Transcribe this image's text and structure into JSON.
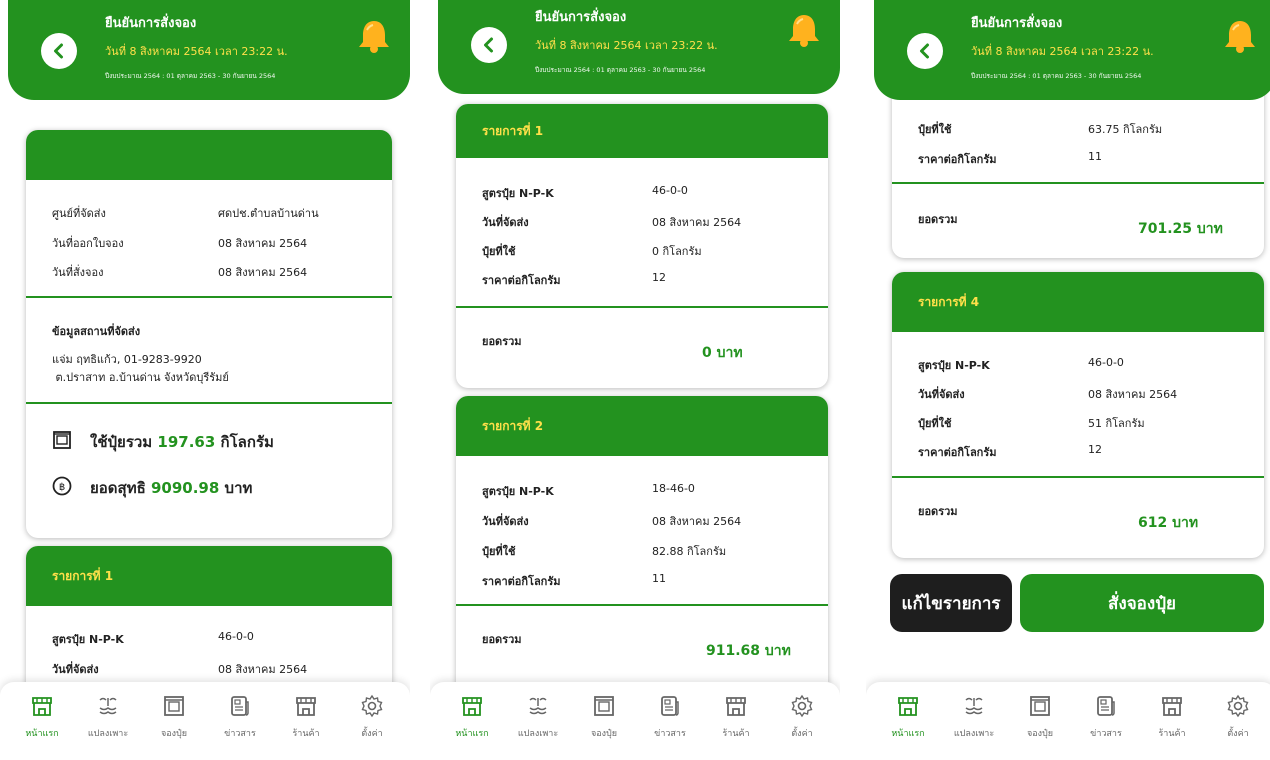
{
  "header": {
    "title": "ยืนยันการสั่งจอง",
    "date": "วันที่ 8 สิงหาคม 2564 เวลา 23:22 น.",
    "budget": "ปีงบประมาณ 2564 : 01 ตุลาคม 2563 - 30 กันยายน 2564"
  },
  "summary": {
    "center_label": "ศูนย์ที่จัดส่ง",
    "center_value": "ศดปช.ตำบลบ้านด่าน",
    "issue_label": "วันที่ออกใบจอง",
    "issue_value": "08 สิงหาคม 2564",
    "order_label": "วันที่สั่งจอง",
    "order_value": "08 สิงหาคม 2564",
    "address_title": "ข้อมูลสถานที่จัดส่ง",
    "address_line1": "แจ่ม ฤทธิแก้ว, 01-9283-9920",
    "address_line2": " ต.ปราสาท อ.บ้านด่าน จังหวัดบุรีรัมย์",
    "total_kg_prefix": "ใช้ปุ๋ยรวม",
    "total_kg_value": "197.63",
    "total_kg_unit": "กิโลกรัม",
    "net_prefix": "ยอดสุทธิ",
    "net_value": "9090.98",
    "net_unit": "บาท"
  },
  "labels": {
    "formula": "สูตรปุ๋ย N-P-K",
    "ship_date": "วันที่จัดส่ง",
    "used": "ปุ๋ยที่ใช้",
    "price": "ราคาต่อกิโลกรัม",
    "total": "ยอดรวม"
  },
  "items": [
    {
      "title": "รายการที่ 1",
      "formula": "46-0-0",
      "ship_date": "08 สิงหาคม 2564",
      "used": "0 กิโลกรัม",
      "price": "12",
      "total": "0 บาท"
    },
    {
      "title": "รายการที่ 2",
      "formula": "18-46-0",
      "ship_date": "08 สิงหาคม 2564",
      "used": "82.88 กิโลกรัม",
      "price": "11",
      "total": "911.68 บาท"
    },
    {
      "used": "63.75 กิโลกรัม",
      "price": "11",
      "total": "701.25 บาท"
    },
    {
      "title": "รายการที่ 4",
      "formula": "46-0-0",
      "ship_date": "08 สิงหาคม 2564",
      "used": "51 กิโลกรัม",
      "price": "12",
      "total": "612 บาท"
    }
  ],
  "actions": {
    "edit": "แก้ไขรายการ",
    "order": "สั่งจองปุ๋ย"
  },
  "nav": [
    "หน้าแรก",
    "แปลงเพาะ",
    "จองปุ๋ย",
    "ข่าวสาร",
    "ร้านค้า",
    "ตั้งค่า"
  ],
  "colors": {
    "primary": "#23921f",
    "accent": "#ffe04a",
    "dark": "#1e1e1e"
  }
}
